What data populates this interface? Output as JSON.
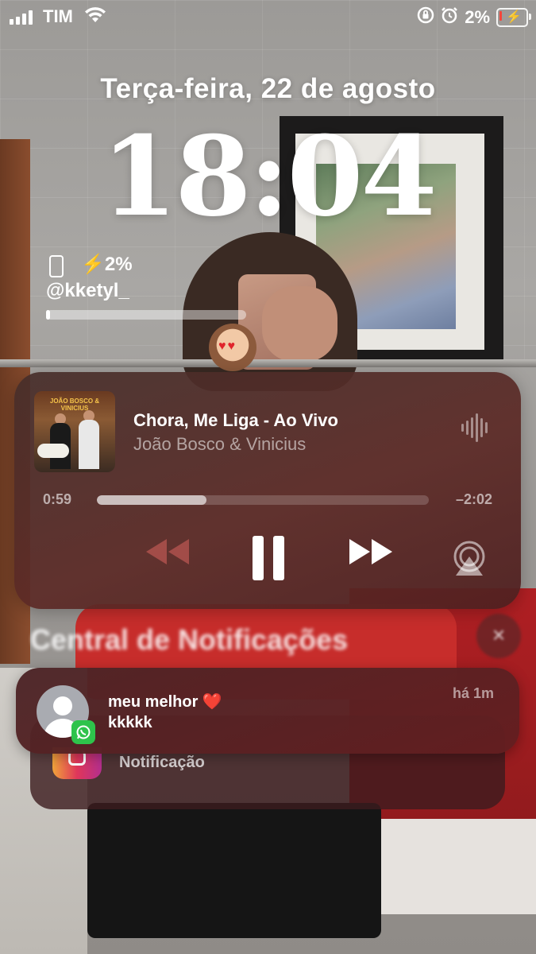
{
  "status_bar": {
    "carrier": "TIM",
    "battery_percent": "2%",
    "icons": [
      "signal-icon",
      "wifi-icon",
      "rotation-lock-icon",
      "alarm-icon",
      "battery-charging-icon"
    ]
  },
  "lock_screen": {
    "date": "Terça-feira, 22 de agosto",
    "time": "18:04"
  },
  "battery_widget": {
    "percent": "2%",
    "username": "@kketyl_",
    "level": 0.02
  },
  "now_playing": {
    "song": "Chora, Me Liga - Ao Vivo",
    "artist": "João Bosco & Vinicius",
    "elapsed": "0:59",
    "remaining": "–2:02",
    "progress": 0.33,
    "art_title": "JOÃO BOSCO & VINICIUS"
  },
  "notification_center": {
    "title": "Central de Notificações",
    "stack_label": "Notificação",
    "notification": {
      "sender": "meu melhor",
      "sender_emoji": "❤️",
      "message": "kkkkk",
      "time_ago": "há 1m",
      "app": "whatsapp"
    }
  },
  "colors": {
    "player_bg": "#5c2a26",
    "notification_bg": "#64201f",
    "whatsapp_green": "#2ec34b",
    "heart_red": "#e8312f"
  }
}
